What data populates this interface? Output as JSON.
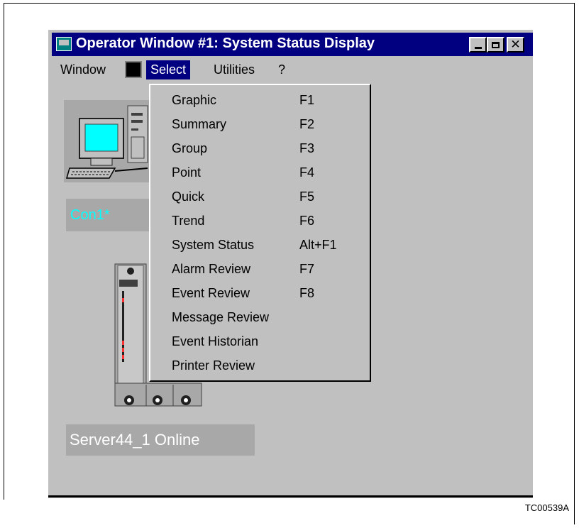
{
  "window": {
    "title": "Operator Window #1: System Status Display"
  },
  "menubar": {
    "items": [
      {
        "label": "Window"
      },
      {
        "label": "Select"
      },
      {
        "label": "Utilities"
      },
      {
        "label": "?"
      }
    ]
  },
  "nodes": {
    "console_label": "Con1*",
    "server_label": "Server44_1 Online"
  },
  "select_menu": {
    "items": [
      {
        "label": "Graphic",
        "shortcut": "F1"
      },
      {
        "label": "Summary",
        "shortcut": "F2"
      },
      {
        "label": "Group",
        "shortcut": "F3"
      },
      {
        "label": "Point",
        "shortcut": "F4"
      },
      {
        "label": "Quick",
        "shortcut": "F5"
      },
      {
        "label": "Trend",
        "shortcut": "F6"
      },
      {
        "label": "System Status",
        "shortcut": "Alt+F1"
      },
      {
        "label": "Alarm Review",
        "shortcut": "F7"
      },
      {
        "label": "Event Review",
        "shortcut": "F8"
      },
      {
        "label": "Message Review",
        "shortcut": ""
      },
      {
        "label": "Event Historian",
        "shortcut": ""
      },
      {
        "label": "Printer Review",
        "shortcut": ""
      }
    ]
  },
  "figure_label": "TC00539A",
  "colors": {
    "titlebar": "#000080",
    "window_bg": "#c0c0c0",
    "console_label_text": "#00ffff",
    "node_label_bg": "#a8a8a8"
  },
  "icons": [
    "app-window-icon",
    "minimize-icon",
    "maximize-icon",
    "close-icon",
    "console-computer-icon",
    "server-module-icon"
  ]
}
